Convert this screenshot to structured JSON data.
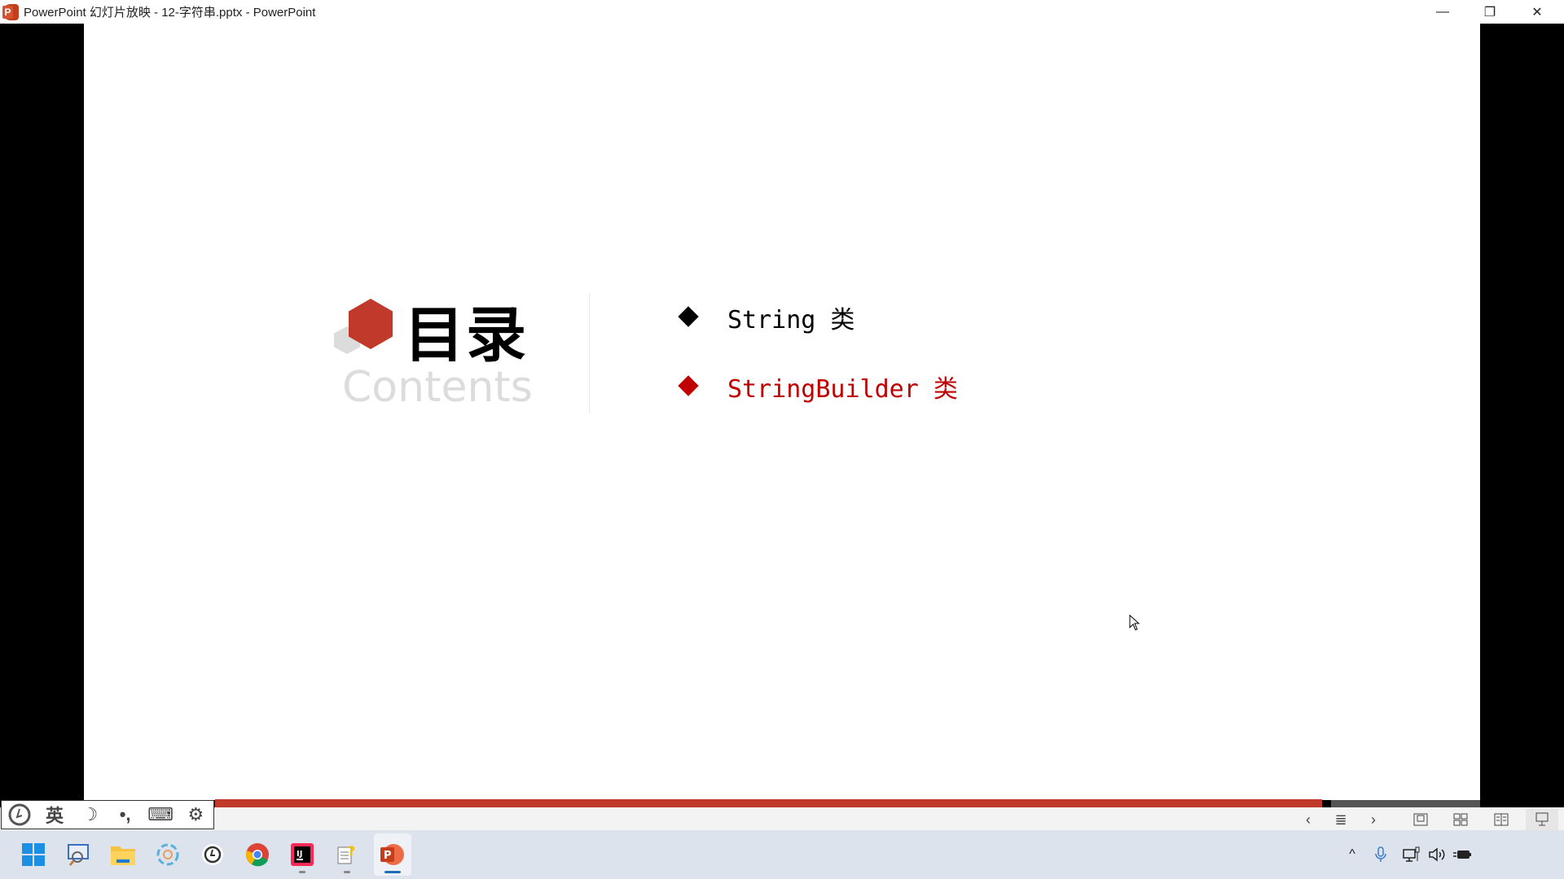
{
  "window": {
    "title": "PowerPoint 幻灯片放映  -  12-字符串.pptx - PowerPoint",
    "app_icon_letter": "P",
    "controls": {
      "minimize": "—",
      "restore": "❐",
      "close": "✕"
    }
  },
  "slide": {
    "title": "目录",
    "subtitle": "Contents",
    "items": [
      {
        "label": "String 类",
        "color": "#000000"
      },
      {
        "label": "StringBuilder 类",
        "color": "#c00000"
      }
    ],
    "accent_red": "#c0392b",
    "accent_grey": "#dcdcdc"
  },
  "slideshow_bar": {
    "progress_fraction": 0.88,
    "prev_label": "‹",
    "next_label": "›",
    "menu_label": "≣"
  },
  "ime_toolbar": {
    "items": [
      "ime-logo",
      "英",
      "☽",
      "•,",
      "⌨",
      "⚙"
    ]
  },
  "view_buttons": [
    "normal-view",
    "slide-sorter",
    "reading-view",
    "slideshow"
  ],
  "taskbar": {
    "apps": [
      "windows-start",
      "remote-desktop",
      "file-explorer",
      "pinwheel-app",
      "clock-app",
      "chrome",
      "intellij-idea",
      "notes-help",
      "powerpoint"
    ],
    "tray": [
      "^",
      "mic",
      "network",
      "volume",
      "battery"
    ]
  }
}
